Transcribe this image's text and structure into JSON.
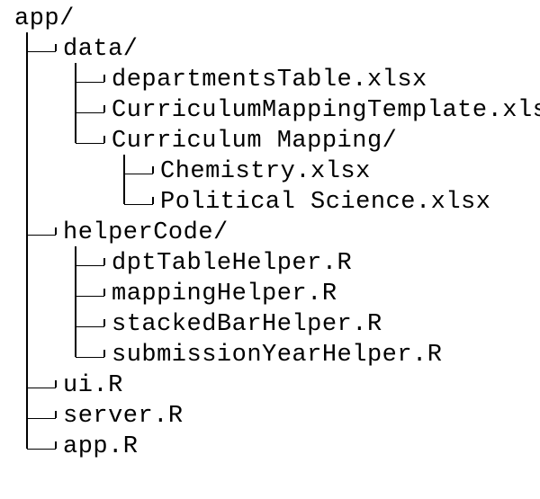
{
  "tree": {
    "root": "app/",
    "data_dir": "data/",
    "data_children": {
      "departmentsTable": "departmentsTable.xlsx",
      "curriculumTemplate": "CurriculumMappingTemplate.xlsx",
      "curriculumMappingDir": "Curriculum Mapping/",
      "curriculumMappingChildren": {
        "chemistry": "Chemistry.xlsx",
        "politicalScience": "Political Science.xlsx"
      }
    },
    "helperCode_dir": "helperCode/",
    "helperCode_children": {
      "dptTableHelper": "dptTableHelper.R",
      "mappingHelper": "mappingHelper.R",
      "stackedBarHelper": "stackedBarHelper.R",
      "submissionYearHelper": "submissionYearHelper.R"
    },
    "ui": "ui.R",
    "server": "server.R",
    "app": "app.R"
  }
}
